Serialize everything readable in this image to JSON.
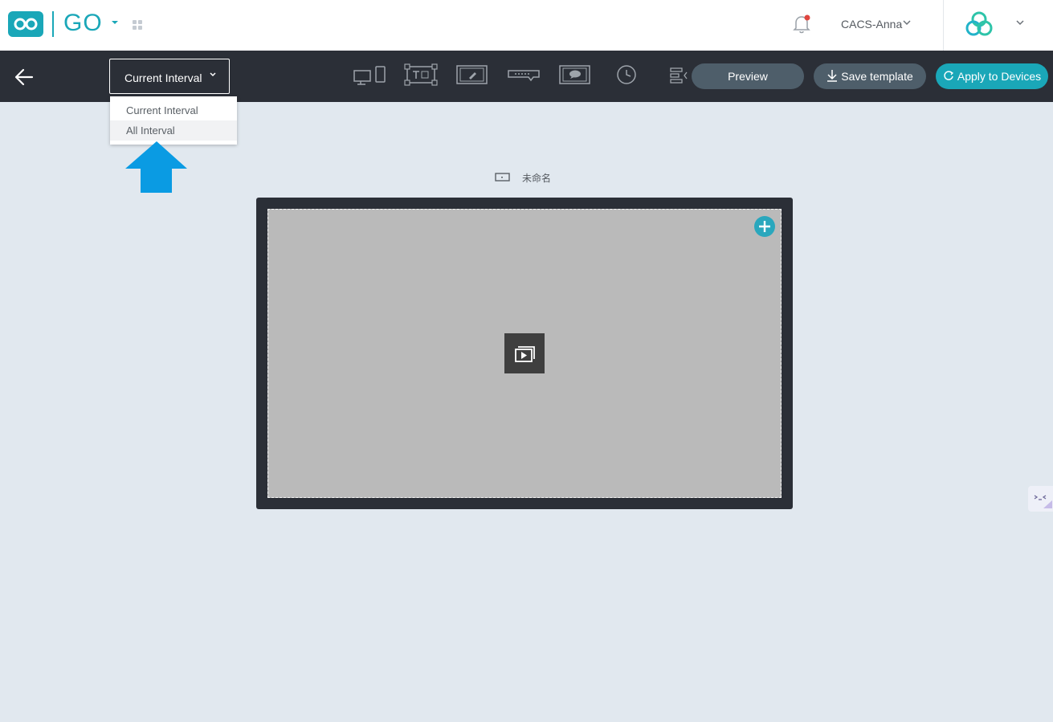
{
  "header": {
    "app_name": "GO",
    "user_name": "CACS-Anna",
    "notification_dot_color": "#e0463f"
  },
  "toolbar": {
    "interval_select": {
      "selected": "Current Interval"
    },
    "tools": [
      "device-orientation",
      "text-layout",
      "draw-frame",
      "ticker",
      "bubble-frame",
      "clock",
      "align"
    ],
    "preview_label": "Preview",
    "save_label": "Save template",
    "apply_label": "Apply to Devices"
  },
  "dropdown": {
    "options": [
      "Current Interval",
      "All Interval"
    ],
    "highlighted": "All Interval"
  },
  "canvas": {
    "screen_name": "未命名",
    "accent_color": "#2aa7bd"
  },
  "colors": {
    "brand": "#1aa7b8",
    "toolbar_bg": "#2b2f37",
    "page_bg": "#e1e8ef",
    "annotation_arrow": "#0a9be3"
  }
}
